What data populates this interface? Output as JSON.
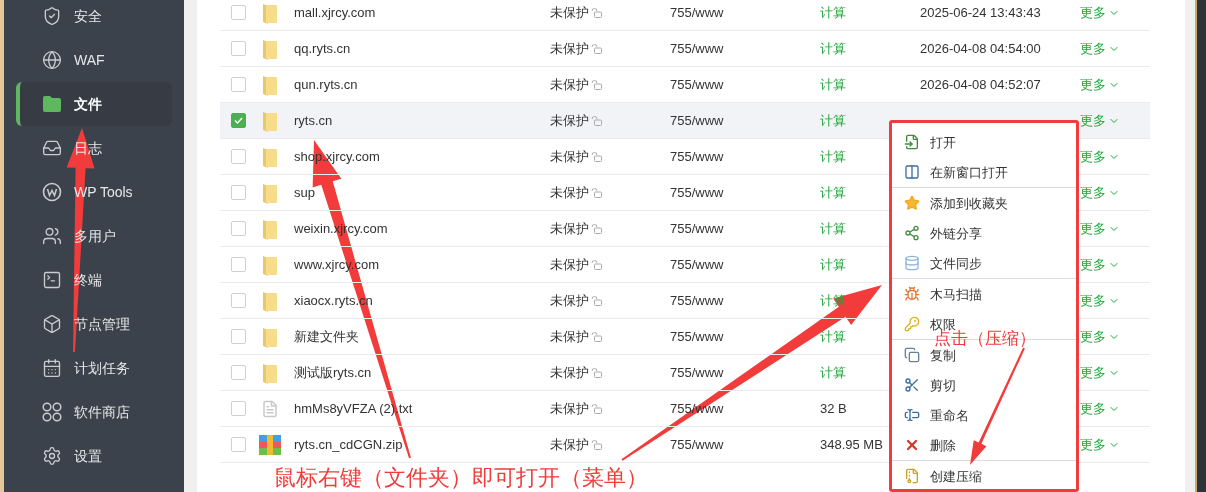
{
  "sidebar": {
    "items": [
      {
        "label": "安全",
        "selected": false
      },
      {
        "label": "WAF",
        "selected": false
      },
      {
        "label": "文件",
        "selected": true
      },
      {
        "label": "日志",
        "selected": false
      },
      {
        "label": "WP Tools",
        "selected": false
      },
      {
        "label": "多用户",
        "selected": false
      },
      {
        "label": "终端",
        "selected": false
      },
      {
        "label": "节点管理",
        "selected": false
      },
      {
        "label": "计划任务",
        "selected": false
      },
      {
        "label": "软件商店",
        "selected": false
      },
      {
        "label": "设置",
        "selected": false
      }
    ]
  },
  "table": {
    "rows": [
      {
        "kind": "folder",
        "name": "mall.xjrcy.com",
        "checked": false,
        "protection": "未保护",
        "permission": "755/www",
        "size": "计算",
        "size_is_action": true,
        "modified": "2025-06-24 13:43:43",
        "more": "更多"
      },
      {
        "kind": "folder",
        "name": "qq.ryts.cn",
        "checked": false,
        "protection": "未保护",
        "permission": "755/www",
        "size": "计算",
        "size_is_action": true,
        "modified": "2026-04-08 04:54:00",
        "more": "更多"
      },
      {
        "kind": "folder",
        "name": "qun.ryts.cn",
        "checked": false,
        "protection": "未保护",
        "permission": "755/www",
        "size": "计算",
        "size_is_action": true,
        "modified": "2026-04-08 04:52:07",
        "more": "更多"
      },
      {
        "kind": "folder",
        "name": "ryts.cn",
        "checked": true,
        "protection": "未保护",
        "permission": "755/www",
        "size": "计算",
        "size_is_action": true,
        "more": "更多"
      },
      {
        "kind": "folder",
        "name": "shop.xjrcy.com",
        "checked": false,
        "protection": "未保护",
        "permission": "755/www",
        "size": "计算",
        "size_is_action": true,
        "more": "更多"
      },
      {
        "kind": "folder",
        "name": "sup",
        "checked": false,
        "protection": "未保护",
        "permission": "755/www",
        "size": "计算",
        "size_is_action": true,
        "more": "更多"
      },
      {
        "kind": "folder",
        "name": "weixin.xjrcy.com",
        "checked": false,
        "protection": "未保护",
        "permission": "755/www",
        "size": "计算",
        "size_is_action": true,
        "more": "更多"
      },
      {
        "kind": "folder",
        "name": "www.xjrcy.com",
        "checked": false,
        "protection": "未保护",
        "permission": "755/www",
        "size": "计算",
        "size_is_action": true,
        "more": "更多"
      },
      {
        "kind": "folder",
        "name": "xiaocx.ryts.cn",
        "checked": false,
        "protection": "未保护",
        "permission": "755/www",
        "size": "计算",
        "size_is_action": true,
        "more": "更多"
      },
      {
        "kind": "folder",
        "name": "新建文件夹",
        "checked": false,
        "protection": "未保护",
        "permission": "755/www",
        "size": "计算",
        "size_is_action": true,
        "more": "更多"
      },
      {
        "kind": "folder",
        "name": "测试版ryts.cn",
        "checked": false,
        "protection": "未保护",
        "permission": "755/www",
        "size": "计算",
        "size_is_action": true,
        "more": "更多"
      },
      {
        "kind": "text",
        "name": "hmMs8yVFZA (2).txt",
        "checked": false,
        "protection": "未保护",
        "permission": "755/www",
        "size": "32 B",
        "size_is_action": false,
        "more": "更多"
      },
      {
        "kind": "zip",
        "name": "ryts.cn_cdCGN.zip",
        "checked": false,
        "protection": "未保护",
        "permission": "755/www",
        "size": "348.95 MB",
        "size_is_action": false,
        "more": "更多"
      }
    ]
  },
  "context_menu": {
    "groups": [
      [
        "打开",
        "在新窗口打开"
      ],
      [
        "添加到收藏夹",
        "外链分享",
        "文件同步"
      ],
      [
        "木马扫描",
        "权限"
      ],
      [
        "复制",
        "剪切",
        "重命名",
        "删除"
      ],
      [
        "创建压缩"
      ]
    ]
  },
  "annotations": [
    {
      "text": "鼠标右键（文件夹）即可打开（菜单）"
    },
    {
      "text": "点击（压缩）"
    }
  ]
}
